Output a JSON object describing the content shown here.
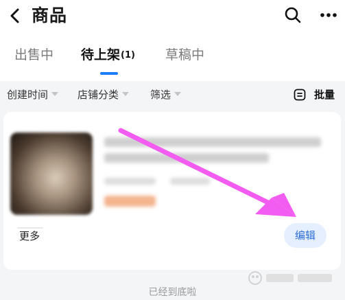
{
  "header": {
    "title": "商品"
  },
  "tabs": [
    {
      "label": "出售中"
    },
    {
      "label": "待上架",
      "count": "(1)"
    },
    {
      "label": "草稿中"
    }
  ],
  "filters": [
    {
      "label": "创建时间"
    },
    {
      "label": "店铺分类"
    },
    {
      "label": "筛选"
    }
  ],
  "batch_label": "批量",
  "card": {
    "more_label": "更多",
    "edit_label": "编辑"
  },
  "footer_text": "已经到底啦",
  "colors": {
    "accent": "#1b7dff",
    "annotation_arrow": "#f25cf0"
  }
}
